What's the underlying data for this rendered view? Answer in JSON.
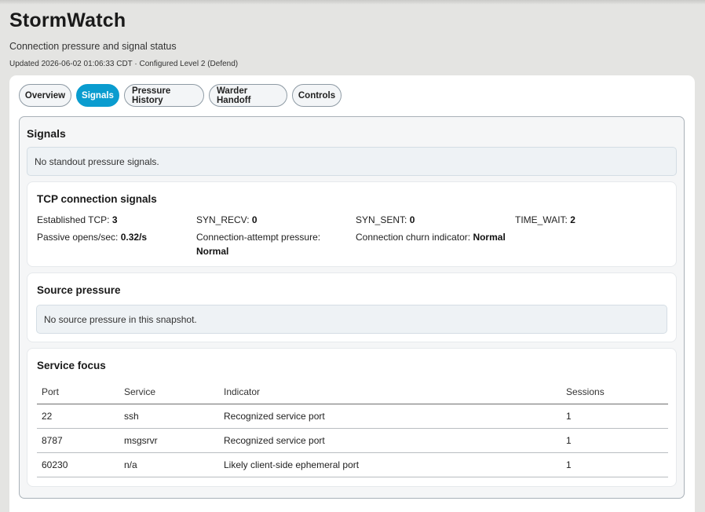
{
  "app": {
    "title": "StormWatch",
    "subtitle": "Connection pressure and signal status",
    "updated": "Updated 2026-06-02 01:06:33 CDT · Configured Level 2 (Defend)"
  },
  "tabs": [
    {
      "label": "Overview",
      "active": false
    },
    {
      "label": "Signals",
      "active": true
    },
    {
      "label": "Pressure History",
      "active": false
    },
    {
      "label": "Warder Handoff",
      "active": false
    },
    {
      "label": "Controls",
      "active": false
    }
  ],
  "signals": {
    "title": "Signals",
    "notice": "No standout pressure signals."
  },
  "tcp": {
    "title": "TCP connection signals",
    "established": {
      "label": "Established TCP:",
      "value": "3"
    },
    "syn_recv": {
      "label": "SYN_RECV:",
      "value": "0"
    },
    "syn_sent": {
      "label": "SYN_SENT:",
      "value": "0"
    },
    "time_wait": {
      "label": "TIME_WAIT:",
      "value": "2"
    },
    "passive_opens": {
      "label": "Passive opens/sec:",
      "value": "0.32/s"
    },
    "attempt_pressure": {
      "label": "Connection-attempt pressure:",
      "value": "Normal"
    },
    "churn": {
      "label": "Connection churn indicator:",
      "value": "Normal"
    }
  },
  "source_pressure": {
    "title": "Source pressure",
    "notice": "No source pressure in this snapshot."
  },
  "service_focus": {
    "title": "Service focus",
    "columns": [
      "Port",
      "Service",
      "Indicator",
      "Sessions"
    ],
    "rows": [
      [
        "22",
        "ssh",
        "Recognized service port",
        "1"
      ],
      [
        "8787",
        "msgsrvr",
        "Recognized service port",
        "1"
      ],
      [
        "60230",
        "n/a",
        "Likely client-side ephemeral port",
        "1"
      ]
    ]
  },
  "colors": {
    "accent": "#0a9ccf",
    "background": "#e4e4e2",
    "notice_bg": "#eef2f5"
  }
}
